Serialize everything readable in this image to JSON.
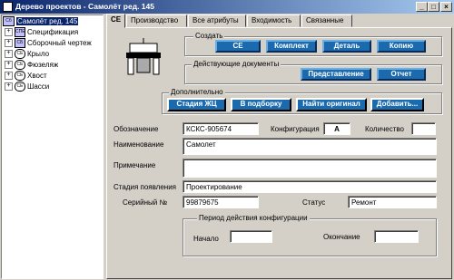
{
  "window": {
    "title": "Дерево проектов - Самолёт ред. 145"
  },
  "titlebar_buttons": [
    "_",
    "□",
    "×"
  ],
  "tree": {
    "root": "Самолёт ред. 145",
    "items": [
      {
        "label": "Спецификация",
        "icon": "СПЕ"
      },
      {
        "label": "Сборочный чертеж",
        "icon": "СБ"
      },
      {
        "label": "Крыло",
        "icon": "СЕ"
      },
      {
        "label": "Фюзеляж",
        "icon": "СЕ"
      },
      {
        "label": "Хвост",
        "icon": "СЕ"
      },
      {
        "label": "Шасси",
        "icon": "СЕ"
      }
    ]
  },
  "tabs": [
    "СЕ",
    "Производство",
    "Все атрибуты",
    "Входимость",
    "Связанные"
  ],
  "create_group": {
    "title": "Создать",
    "buttons": [
      "СЕ",
      "Комплект",
      "Деталь",
      "Копию"
    ]
  },
  "docs_group": {
    "title": "Действующие документы",
    "buttons": [
      "Представление",
      "Отчет"
    ]
  },
  "extra_group": {
    "title": "Дополнительно",
    "buttons": [
      "Стадия ЖЦ",
      "В подборку",
      "Найти оригинал",
      "Добавить..."
    ]
  },
  "form": {
    "designation_label": "Обозначение",
    "designation_value": "КСКС-905674",
    "config_label": "Конфигурация",
    "config_value": "A",
    "qty_label": "Количество",
    "qty_value": "",
    "name_label": "Наименование",
    "name_value": "Самолет",
    "note_label": "Примечание",
    "note_value": "",
    "stage_label": "Стадия появления",
    "stage_value": "Проектирование",
    "serial_label": "Серийный №",
    "serial_value": "99879675",
    "status_label": "Статус",
    "status_value": "Ремонт"
  },
  "period_group": {
    "title": "Период действия конфигурации",
    "start_label": "Начало",
    "start_value": "",
    "end_label": "Окончание",
    "end_value": ""
  },
  "colors": {
    "titlebar": "#0a246a",
    "button": "#1a6aad",
    "face": "#d4d0c8"
  }
}
